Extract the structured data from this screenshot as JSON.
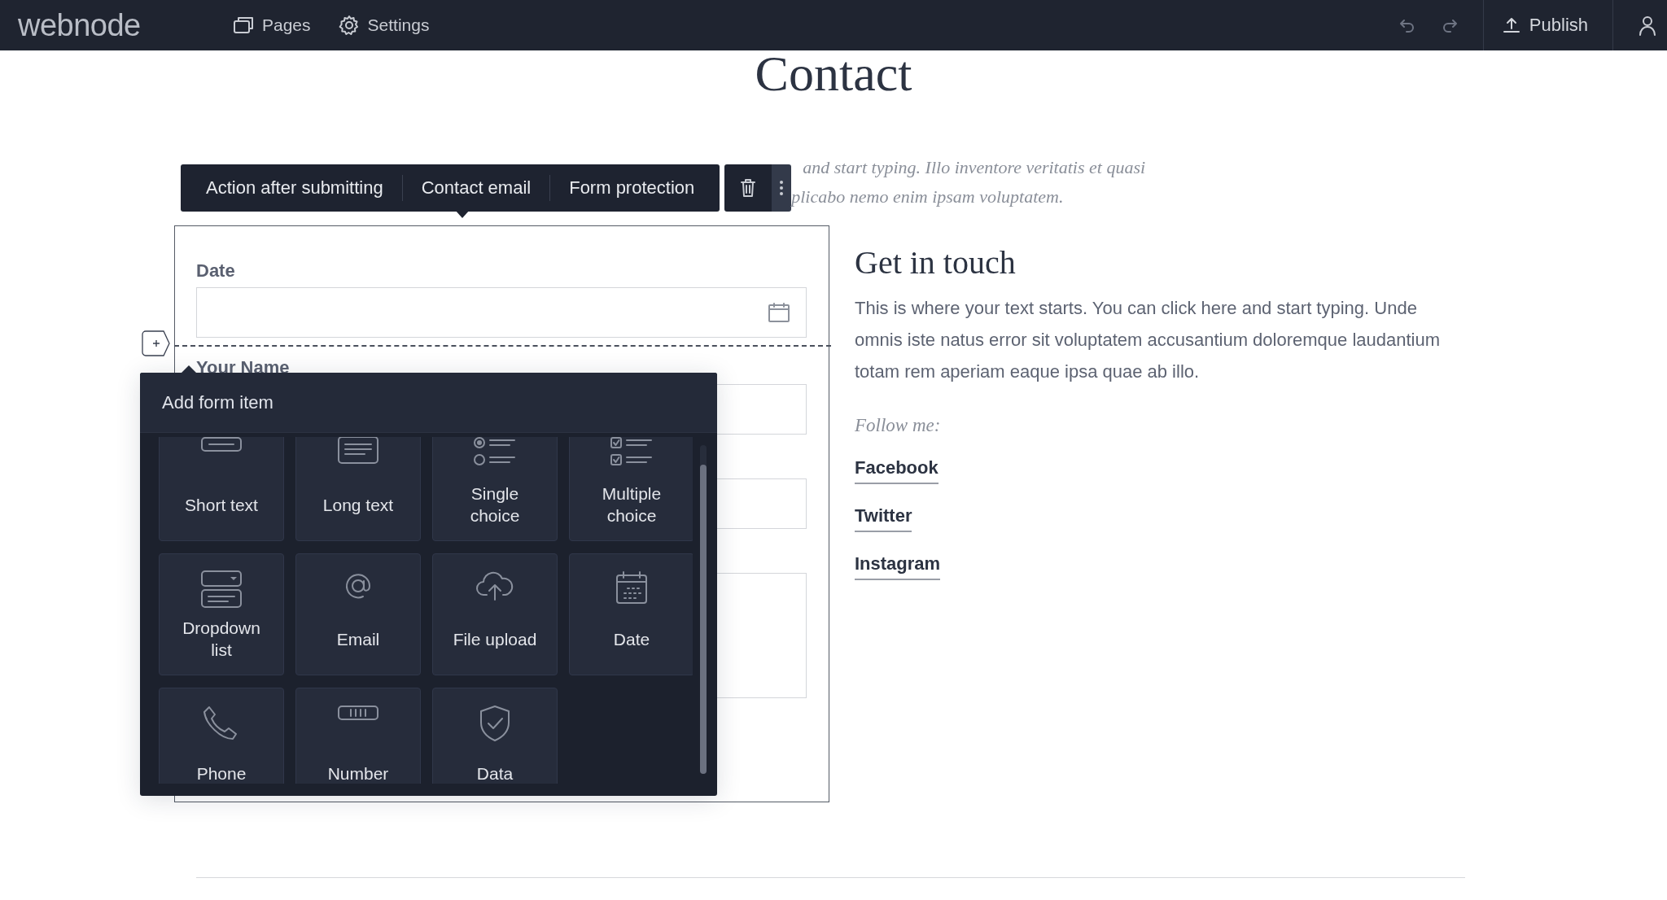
{
  "topbar": {
    "logo": "webnode",
    "nav": [
      {
        "label": "Pages",
        "kind": "pages"
      },
      {
        "label": "Settings",
        "kind": "settings"
      }
    ],
    "history": [
      {
        "kind": "undo"
      },
      {
        "kind": "redo"
      }
    ],
    "publish": "Publish"
  },
  "page": {
    "title": "Contact",
    "intro_lines": [
      "and start typing. Illo inventore veritatis et quasi",
      "plicabo nemo enim ipsam voluptatem."
    ],
    "form_toolbar": {
      "items": [
        "Action after submitting",
        "Contact email",
        "Form protection"
      ]
    },
    "form": {
      "fields": [
        {
          "label": "Date",
          "kind": "date"
        },
        {
          "label": "Your Name",
          "kind": "text"
        },
        {
          "kind": "text"
        },
        {
          "kind": "textarea"
        }
      ]
    },
    "add_form_item": {
      "title": "Add form item",
      "items": [
        {
          "label": "Short text",
          "kind": "short-text"
        },
        {
          "label": "Long text",
          "kind": "long-text"
        },
        {
          "label": "Single choice",
          "kind": "single-choice"
        },
        {
          "label": "Multiple choice",
          "kind": "multiple-choice"
        },
        {
          "label": "Dropdown list",
          "kind": "dropdown"
        },
        {
          "label": "Email",
          "kind": "email"
        },
        {
          "label": "File upload",
          "kind": "file-upload"
        },
        {
          "label": "Date",
          "kind": "date"
        },
        {
          "label": "Phone",
          "kind": "phone"
        },
        {
          "label": "Number",
          "kind": "number"
        },
        {
          "label": "Data",
          "kind": "data-consent"
        }
      ]
    },
    "contact": {
      "heading": "Get in touch",
      "text": "This is where your text starts. You can click here and start typing. Unde omnis iste natus error sit voluptatem accusantium doloremque laudantium totam rem aperiam eaque ipsa quae ab illo.",
      "follow": "Follow me:",
      "links": [
        "Facebook",
        "Twitter",
        "Instagram"
      ]
    }
  }
}
